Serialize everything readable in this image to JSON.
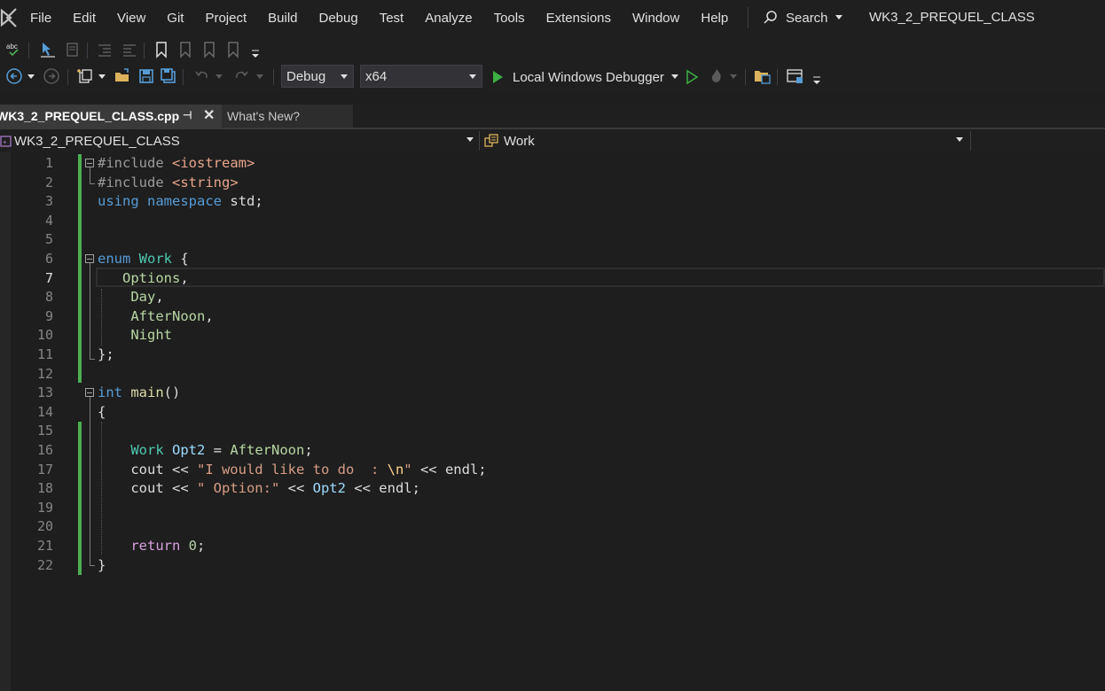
{
  "menu": {
    "items": [
      "File",
      "Edit",
      "View",
      "Git",
      "Project",
      "Build",
      "Debug",
      "Test",
      "Analyze",
      "Tools",
      "Extensions",
      "Window",
      "Help"
    ],
    "search_label": "Search",
    "window_title": "WK3_2_PREQUEL_CLASS"
  },
  "toolbar": {
    "config_value": "Debug",
    "platform_value": "x64",
    "debugger_label": "Local Windows Debugger"
  },
  "tabs": [
    {
      "label": "WK3_2_PREQUEL_CLASS.cpp",
      "active": true
    },
    {
      "label": "What's New?",
      "active": false
    }
  ],
  "navbar": {
    "project_scope": "WK3_2_PREQUEL_CLASS",
    "member_scope": "Work"
  },
  "editor": {
    "current_line": 7,
    "line_numbers": [
      "1",
      "2",
      "3",
      "4",
      "5",
      "6",
      "7",
      "8",
      "9",
      "10",
      "11",
      "12",
      "13",
      "14",
      "15",
      "16",
      "17",
      "18",
      "19",
      "20",
      "21",
      "22"
    ]
  },
  "colors": {
    "accent_green": "#4caf50",
    "play_green": "#3cb043",
    "keyword_blue": "#569cd6",
    "type_teal": "#4ec9b0",
    "string": "#d69d85"
  }
}
